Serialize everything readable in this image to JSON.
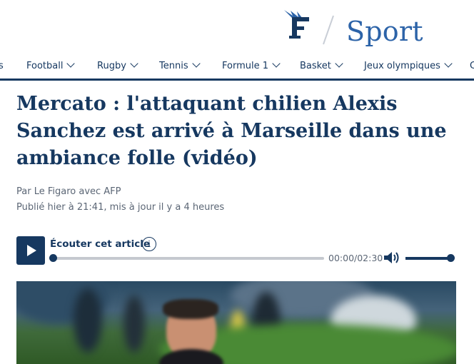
{
  "header": {
    "logo_alt": "Le Figaro",
    "section_title": "Sport"
  },
  "nav": {
    "items": [
      {
        "label": "s",
        "has_chevron": false
      },
      {
        "label": "Football",
        "has_chevron": true
      },
      {
        "label": "Rugby",
        "has_chevron": true
      },
      {
        "label": "Tennis",
        "has_chevron": true
      },
      {
        "label": "Formule 1",
        "has_chevron": true
      },
      {
        "label": "Basket",
        "has_chevron": true
      },
      {
        "label": "Jeux olympiques",
        "has_chevron": true
      },
      {
        "label": "C",
        "has_chevron": false
      }
    ]
  },
  "article": {
    "title": "Mercato : l'attaquant chilien Alexis Sanchez est arrivé à Marseille dans une ambiance folle (vidéo)",
    "byline": "Par Le Figaro avec AFP",
    "published": "Publié hier à 21:41, mis à jour il y a 4 heures"
  },
  "audio_player": {
    "play_icon": "play-icon",
    "label": "Écouter cet article",
    "info_icon": "info-icon",
    "current_time": "00:00",
    "duration": "02:30",
    "time_display": "00:00/02:30",
    "progress_fraction": 0,
    "volume_icon": "volume-icon",
    "volume_fraction": 1.0
  },
  "colors": {
    "brand_navy": "#163860",
    "sport_blue": "#2c63a8",
    "muted_text": "#5b6675",
    "track_grey": "#c5c9cf"
  }
}
